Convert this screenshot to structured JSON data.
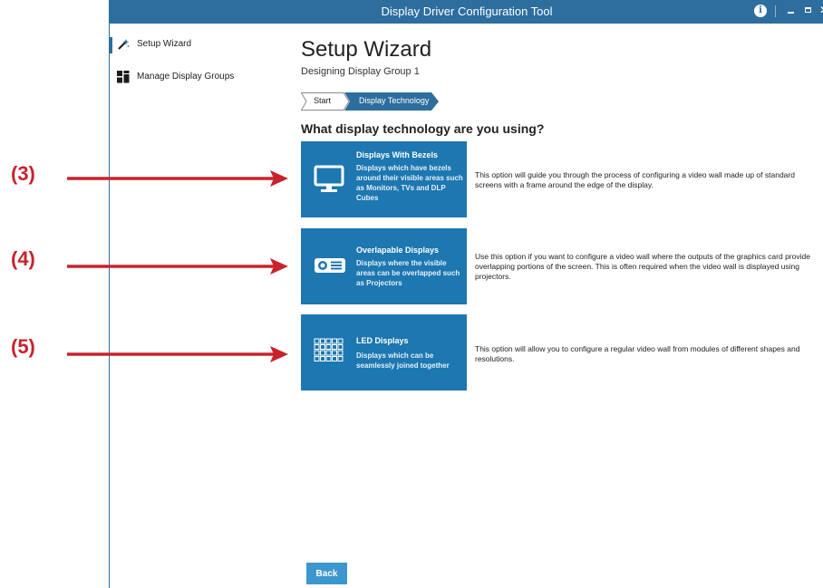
{
  "window": {
    "title": "Display Driver Configuration Tool",
    "info_glyph": "i",
    "close_glyph": "✕"
  },
  "sidebar": {
    "items": [
      {
        "label": "Setup Wizard",
        "icon": "wand-icon",
        "active": true
      },
      {
        "label": "Manage Display Groups",
        "icon": "grid-icon",
        "active": false
      }
    ]
  },
  "main": {
    "title": "Setup Wizard",
    "subtitle": "Designing Display Group 1",
    "breadcrumbs": [
      "Start",
      "Display Technology"
    ],
    "question": "What display technology are you using?",
    "options": [
      {
        "title": "Displays With Bezels",
        "card_description": "Displays which have bezels around their visible areas such as Monitors, TVs and DLP Cubes",
        "description": "This option will guide you through the process of configuring a video wall made up of standard screens with a frame around the edge of the display.",
        "icon": "monitor-icon"
      },
      {
        "title": "Overlapable Displays",
        "card_description": "Displays where the visible areas can be overlapped such as Projectors",
        "description": "Use this option if you want to configure a video wall where the outputs of the graphics card provide overlapping portions of the screen. This is often required when the video wall is displayed using projectors.",
        "icon": "projector-icon"
      },
      {
        "title": "LED Displays",
        "card_description": "Displays which can be seamlessly joined together",
        "description": "This option will allow you to configure a regular video wall from modules of different shapes and resolutions.",
        "icon": "led-grid-icon"
      }
    ],
    "back_label": "Back"
  },
  "annotations": {
    "labels": [
      "(3)",
      "(4)",
      "(5)"
    ],
    "color": "#c8232c"
  },
  "colors": {
    "titlebar": "#2d6e9e",
    "card": "#1d77b0",
    "back_button": "#3d97cf"
  }
}
